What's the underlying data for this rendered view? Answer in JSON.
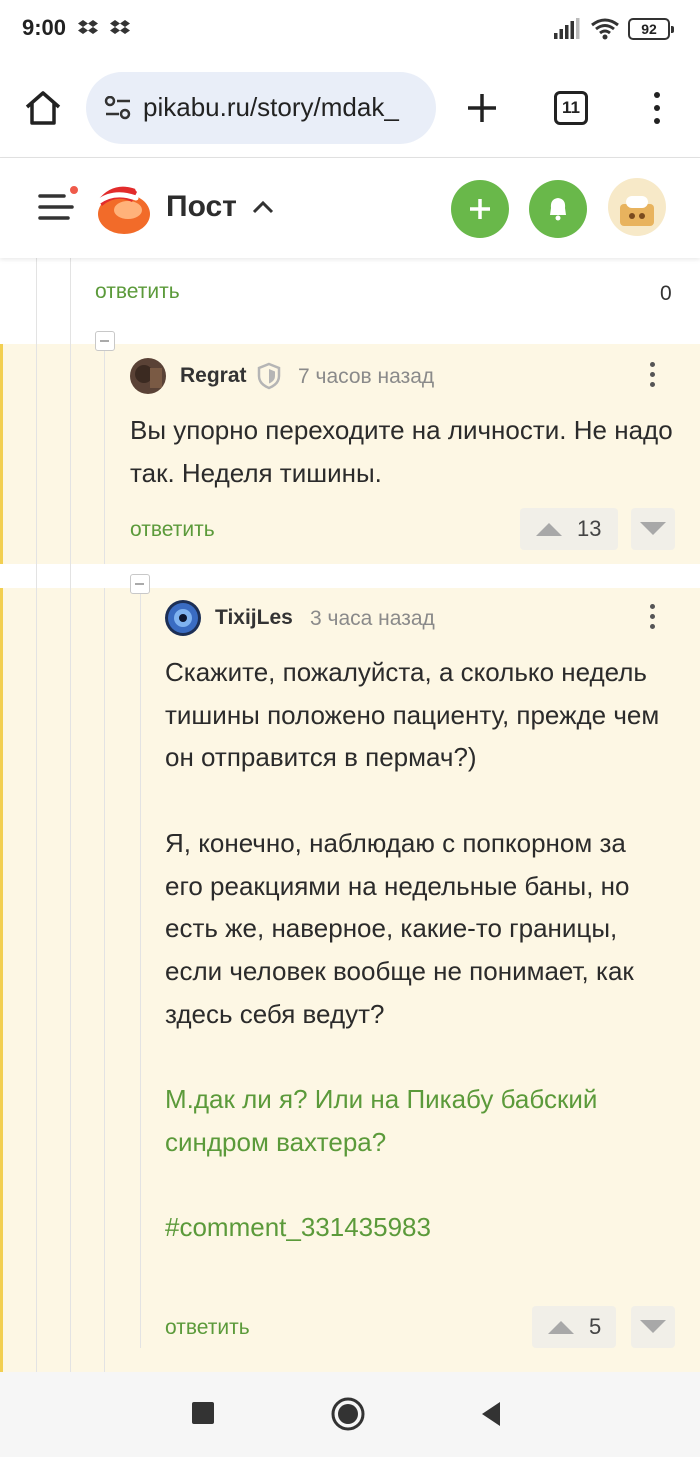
{
  "status_bar": {
    "time": "9:00",
    "battery": "92",
    "icons": [
      "dropbox-icon",
      "dropbox-icon",
      "signal-icon",
      "wifi-icon",
      "battery-icon"
    ]
  },
  "browser": {
    "url": "pikabu.ru/story/mdak_",
    "tab_count": "11",
    "icons": [
      "home-icon",
      "site-settings-icon",
      "new-tab-icon",
      "tabs-icon",
      "more-icon"
    ]
  },
  "header": {
    "title": "Пост",
    "icons": [
      "menu-icon",
      "pikabu-logo",
      "chevron-up-icon",
      "add-post-icon",
      "bell-icon",
      "user-avatar"
    ]
  },
  "thread": {
    "prev_reply_label": "ответить",
    "prev_reply_count": "0",
    "comments": [
      {
        "author": "Regrat",
        "time": "7 часов назад",
        "paragraphs": [
          "Вы упорно переходите на личности. Не надо так. Неделя тишины."
        ],
        "reply_label": "ответить",
        "rating": "13"
      },
      {
        "author": "TixijLes",
        "time": "3 часа назад",
        "paragraphs": [
          "Скажите, пожалуйста, а сколько недель тишины положено пациенту, прежде чем он отправится в пермач?)",
          "Я, конечно, наблюдаю с попкорном за его реакциями на недельные баны, но есть же, наверное, какие-то границы, если человек вообще не понимает, как здесь себя ведут?"
        ],
        "links": [
          "М.дак ли я? Или на Пикабу бабский синдром вахтера?",
          "#comment_331435983"
        ],
        "reply_label": "ответить",
        "rating": "5"
      }
    ]
  },
  "colors": {
    "accent_green": "#69b84a",
    "link_green": "#5b9a3a",
    "comment_bg": "#fdf7e4",
    "highlight_bar": "#f2cf51"
  }
}
